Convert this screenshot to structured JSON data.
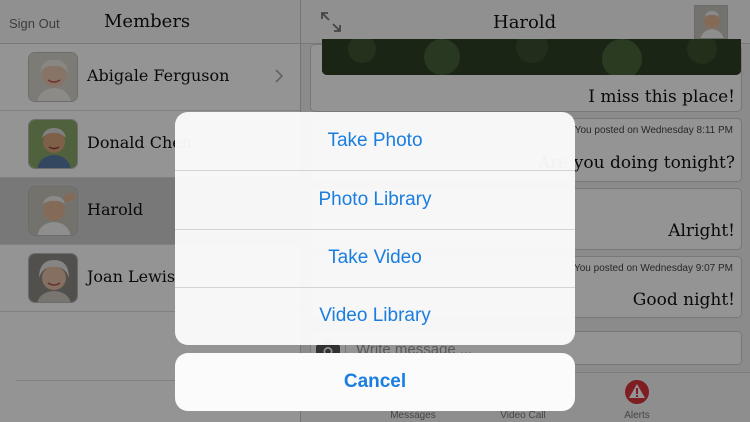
{
  "left_pane": {
    "sign_out_label": "Sign Out",
    "title": "Members",
    "members": [
      {
        "name": "Abigale Ferguson",
        "selected": false
      },
      {
        "name": "Donald Chen",
        "selected": false
      },
      {
        "name": "Harold",
        "selected": true
      },
      {
        "name": "Joan Lewis",
        "selected": false
      }
    ]
  },
  "chat": {
    "title": "Harold",
    "messages": [
      {
        "text": "I miss this place!",
        "meta": ""
      },
      {
        "text": "Are you doing tonight?",
        "meta": "You posted on Wednesday 8:11 PM"
      },
      {
        "text": "Alright!",
        "meta": ""
      },
      {
        "text": "Good night!",
        "meta": "You posted on Wednesday 9:07 PM"
      }
    ],
    "compose_placeholder": "Write message ..."
  },
  "tabs": [
    {
      "label": "Messages",
      "icon": "chat-bubble-icon"
    },
    {
      "label": "Video Call",
      "icon": "video-camera-icon"
    },
    {
      "label": "Alerts",
      "icon": "alert-icon"
    }
  ],
  "action_sheet": {
    "options": [
      "Take Photo",
      "Photo Library",
      "Take Video",
      "Video Library"
    ],
    "cancel_label": "Cancel"
  },
  "colors": {
    "accent": "#1a7ee0",
    "alert_red": "#d9343b",
    "selected_row": "#cfcfcf"
  }
}
